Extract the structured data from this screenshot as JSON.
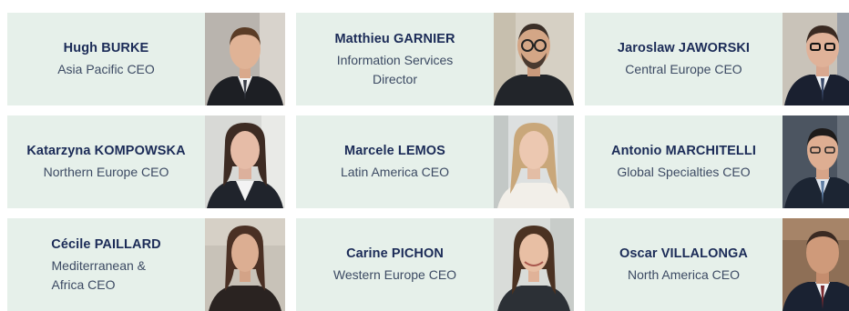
{
  "colors": {
    "card_background": "#e6f0ea",
    "name_text": "#1b2b57",
    "role_text": "#3c4a63"
  },
  "executives": [
    {
      "name": "Hugh BURKE",
      "role": "Asia Pacific CEO"
    },
    {
      "name": "Matthieu GARNIER",
      "role": "Information Services Director"
    },
    {
      "name": "Jaroslaw JAWORSKI",
      "role": "Central Europe CEO"
    },
    {
      "name": "Katarzyna KOMPOWSKA",
      "role": "Northern Europe CEO"
    },
    {
      "name": "Marcele LEMOS",
      "role": "Latin America CEO"
    },
    {
      "name": "Antonio MARCHITELLI",
      "role": "Global Specialties CEO"
    },
    {
      "name": "Cécile PAILLARD",
      "role": "Mediterranean & Africa CEO"
    },
    {
      "name": "Carine PICHON",
      "role": "Western Europe CEO"
    },
    {
      "name": "Oscar VILLALONGA",
      "role": "North America CEO"
    }
  ]
}
